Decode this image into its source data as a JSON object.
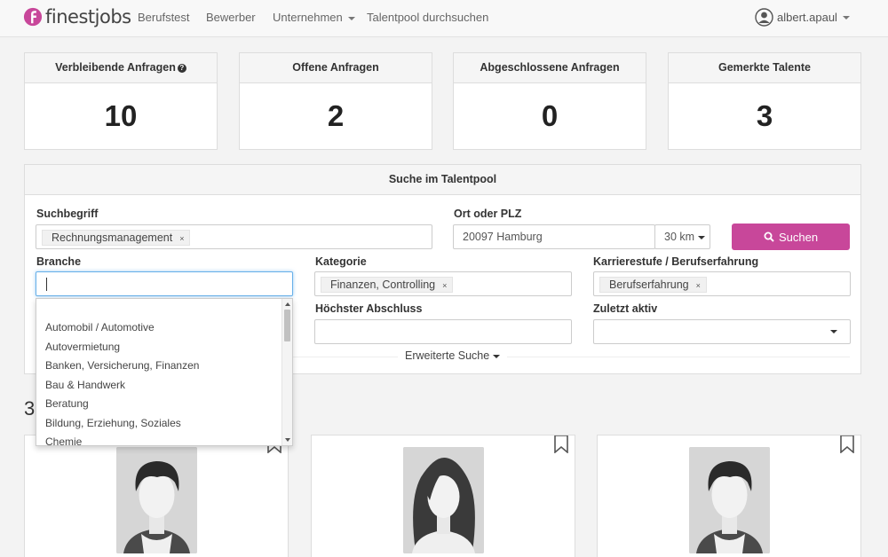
{
  "brand": {
    "name": "finestjobs",
    "color": "#c8479a"
  },
  "nav": {
    "items": [
      {
        "label": "Berufstest"
      },
      {
        "label": "Bewerber"
      },
      {
        "label": "Unternehmen"
      },
      {
        "label": "Talentpool durchsuchen"
      }
    ],
    "user": "albert.apaul"
  },
  "stats": [
    {
      "label": "Verbleibende Anfragen",
      "value": "10"
    },
    {
      "label": "Offene Anfragen",
      "value": "2"
    },
    {
      "label": "Abgeschlossene Anfragen",
      "value": "0"
    },
    {
      "label": "Gemerkte Talente",
      "value": "3"
    }
  ],
  "search": {
    "title": "Suche im Talentpool",
    "keyword": {
      "label": "Suchbegriff",
      "tag": "Rechnungsmanagement"
    },
    "location": {
      "label": "Ort oder PLZ",
      "value": "20097 Hamburg",
      "radius": "30 km"
    },
    "submit_label": "Suchen",
    "branche": {
      "label": "Branche",
      "value": ""
    },
    "kategorie": {
      "label": "Kategorie",
      "tag": "Finanzen, Controlling"
    },
    "karriere": {
      "label": "Karrierestufe / Berufserfahrung",
      "tag": "Berufserfahrung"
    },
    "abschluss": {
      "label": "Höchster Abschluss"
    },
    "zuletzt": {
      "label": "Zuletzt aktiv"
    },
    "advanced_label": "Erweiterte Suche",
    "branche_options": [
      "Automobil / Automotive",
      "Autovermietung",
      "Banken, Versicherung, Finanzen",
      "Bau & Handwerk",
      "Beratung",
      "Bildung, Erziehung, Soziales",
      "Chemie"
    ]
  },
  "results": {
    "count": "3",
    "cards": [
      {
        "avatar": "male-avatar"
      },
      {
        "avatar": "female-avatar"
      },
      {
        "avatar": "male-avatar"
      }
    ]
  }
}
